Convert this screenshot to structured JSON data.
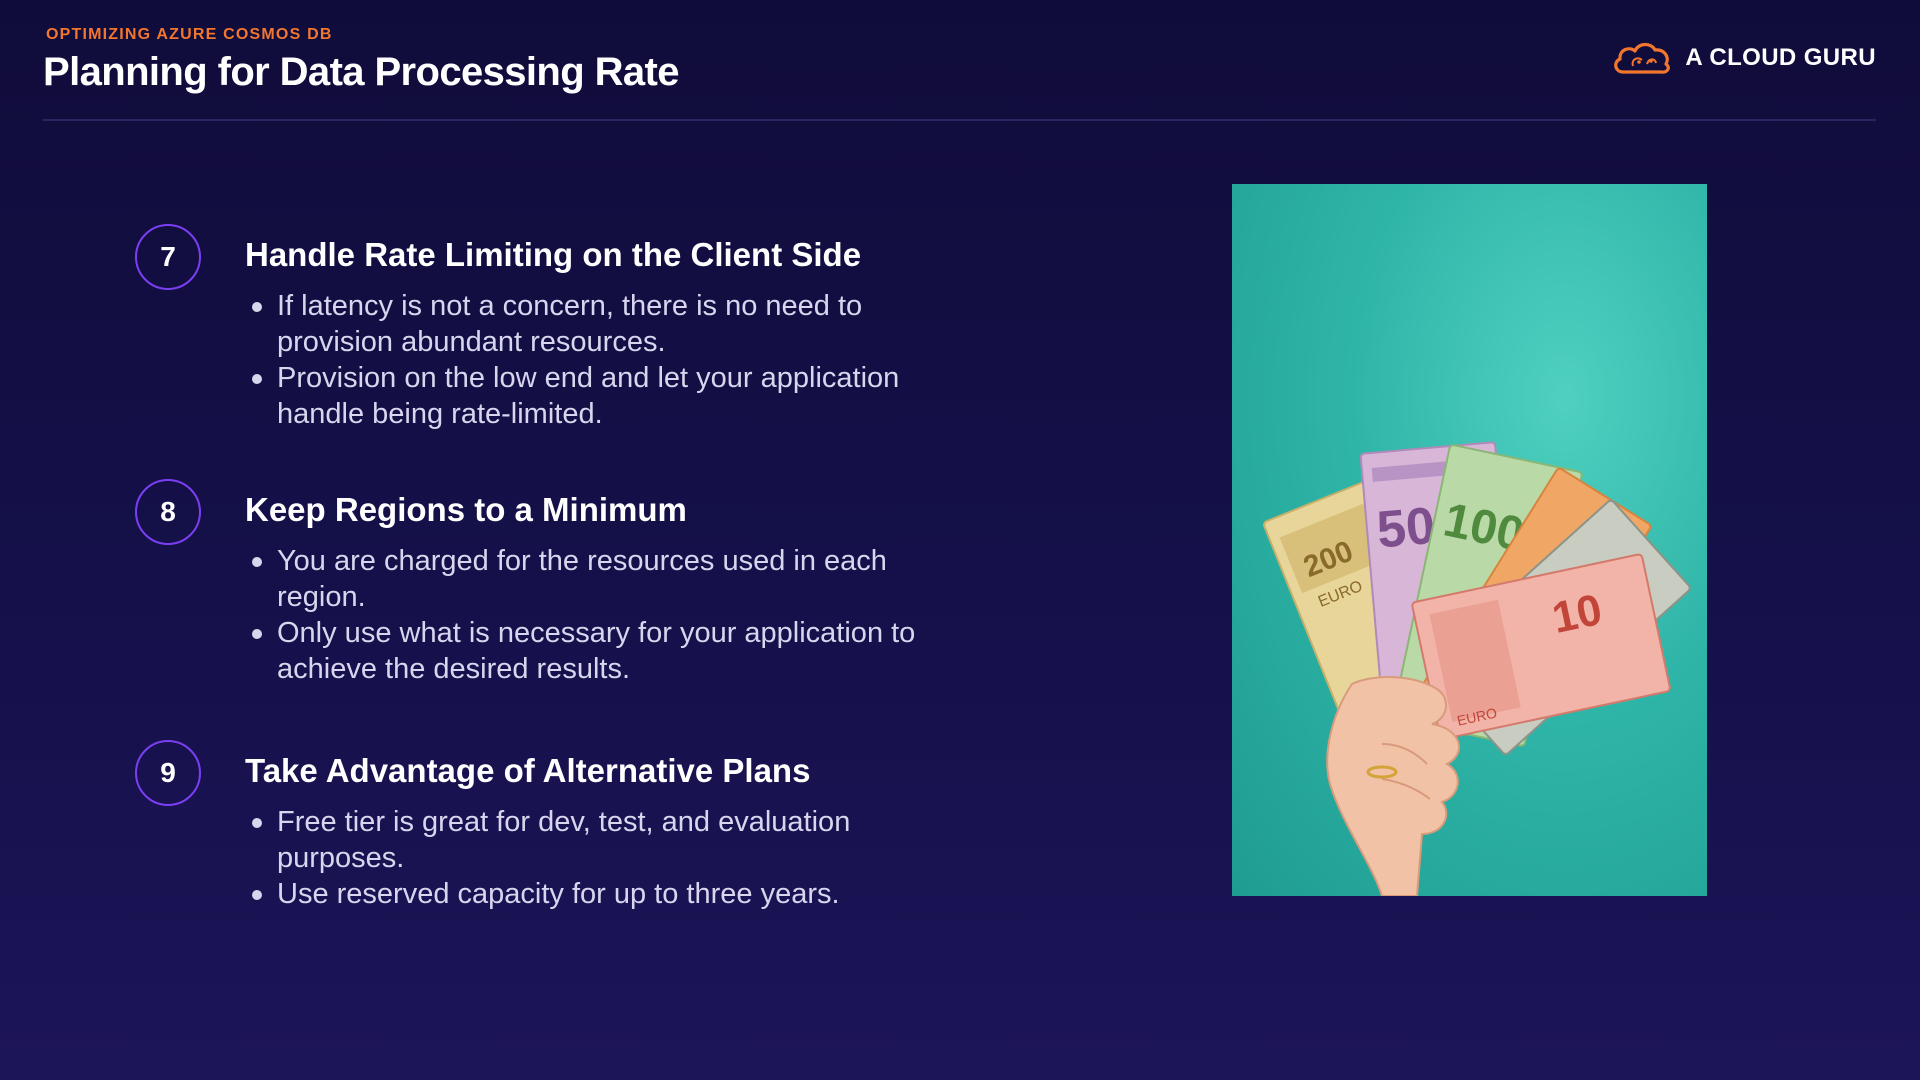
{
  "header": {
    "eyebrow": "OPTIMIZING AZURE COSMOS DB",
    "title": "Planning for Data Processing Rate",
    "brand": "A CLOUD GURU"
  },
  "sections": [
    {
      "number": "7",
      "title": "Handle Rate Limiting on the Client Side",
      "bullets": [
        "If latency is not a concern, there is no need to provision abundant resources.",
        "Provision on the low end and let your application handle being rate-limited."
      ]
    },
    {
      "number": "8",
      "title": "Keep Regions to a Minimum",
      "bullets": [
        "You are charged for the resources used in each region.",
        "Only use what is necessary for your application to achieve the desired results."
      ]
    },
    {
      "number": "9",
      "title": "Take Advantage of Alternative Plans",
      "bullets": [
        "Free tier is great for dev, test, and evaluation purposes.",
        "Use reserved capacity for up to three years."
      ]
    }
  ],
  "photo": {
    "subject": "hand-holding-euro-banknotes-icon",
    "banknote_labels": [
      "200",
      "EURO",
      "500",
      "100",
      "10",
      "EURO"
    ]
  },
  "colors": {
    "accent_orange": "#f2762e",
    "badge_purple": "#7b3ff2",
    "background": "#15104a",
    "photo_teal": "#2fb5a8"
  }
}
